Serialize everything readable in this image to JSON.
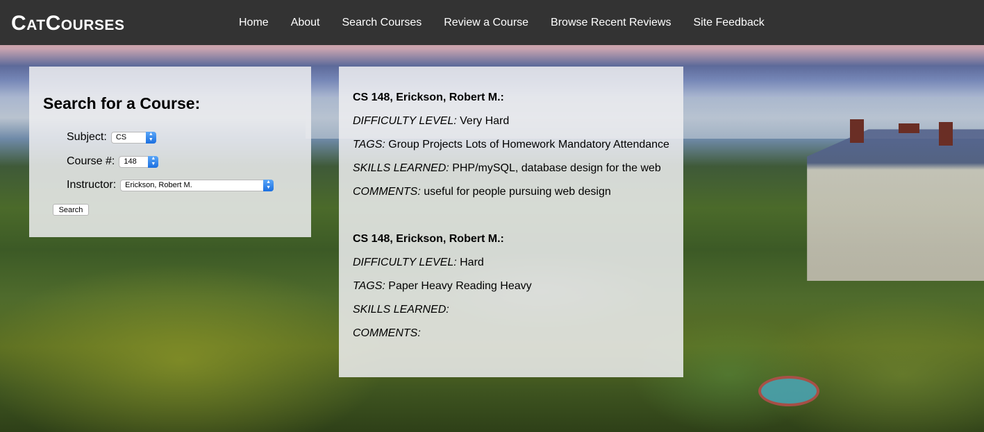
{
  "brand": "CatCourses",
  "nav": [
    "Home",
    "About",
    "Search Courses",
    "Review a Course",
    "Browse Recent Reviews",
    "Site Feedback"
  ],
  "search": {
    "title": "Search for a Course:",
    "subject_label": "Subject:",
    "subject_value": "CS",
    "course_label": "Course #:",
    "course_value": "148",
    "instructor_label": "Instructor:",
    "instructor_value": "Erickson, Robert M.",
    "button_label": "Search"
  },
  "field_labels": {
    "difficulty": "DIFFICULTY LEVEL:",
    "tags": "TAGS:",
    "skills": "SKILLS LEARNED:",
    "comments": "COMMENTS:"
  },
  "reviews": [
    {
      "heading": "CS 148, Erickson, Robert M.:",
      "difficulty": "Very Hard",
      "tags": "Group Projects Lots of Homework Mandatory Attendance",
      "skills": "PHP/mySQL, database design for the web",
      "comments": "useful for people pursuing web design"
    },
    {
      "heading": "CS 148, Erickson, Robert M.:",
      "difficulty": "Hard",
      "tags": "Paper Heavy Reading Heavy",
      "skills": "",
      "comments": ""
    }
  ]
}
